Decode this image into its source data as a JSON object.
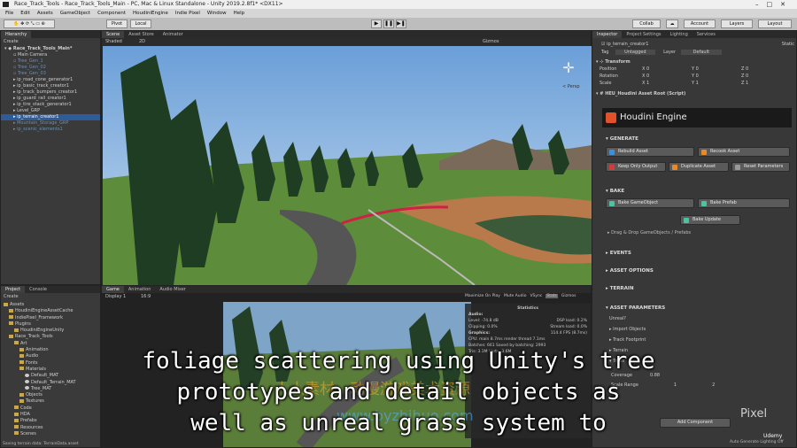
{
  "window": {
    "title": "Race_Track_Tools - Race_Track_Tools_Main - PC, Mac & Linux Standalone - Unity 2019.2.8f1* <DX11>"
  },
  "menu": [
    "File",
    "Edit",
    "Assets",
    "GameObject",
    "Component",
    "HoudiniEngine",
    "Indie Pixel",
    "Window",
    "Help"
  ],
  "toolbar": {
    "pivot": "Pivot",
    "local": "Local",
    "collab": "Collab",
    "account": "Account",
    "layers": "Layers",
    "layout": "Layout"
  },
  "hierarchy": {
    "tab": "Hierarchy",
    "create": "Create",
    "items": [
      {
        "label": "Race_Track_Tools_Main*",
        "state": "scene"
      },
      {
        "label": "Main Camera",
        "state": "normal"
      },
      {
        "label": "Tree_Gen_1",
        "state": "dim"
      },
      {
        "label": "Tree_Gen_02",
        "state": "dim"
      },
      {
        "label": "Tree_Gen_03",
        "state": "dim"
      },
      {
        "label": "ip_road_cone_generator1",
        "state": "normal"
      },
      {
        "label": "ip_basic_track_creator1",
        "state": "normal"
      },
      {
        "label": "ip_track_bumpers_creator1",
        "state": "normal"
      },
      {
        "label": "ip_guard_rail_creator1",
        "state": "normal"
      },
      {
        "label": "ip_tire_stack_generator1",
        "state": "normal"
      },
      {
        "label": "Level_GRP",
        "state": "normal"
      },
      {
        "label": "ip_terrain_creator1",
        "state": "sel"
      },
      {
        "label": "Mountain_Storage_GRP",
        "state": "dim"
      },
      {
        "label": "ip_scenic_elements1",
        "state": "dim"
      }
    ]
  },
  "scene": {
    "tabs": [
      "Scene",
      "Asset Store",
      "Animator"
    ],
    "shading": "Shaded",
    "mode": "2D",
    "gizmos": "Gizmos",
    "persp": "< Persp"
  },
  "project": {
    "tabs": [
      "Project",
      "Console"
    ],
    "create": "Create",
    "items": [
      {
        "label": "Assets",
        "depth": 0
      },
      {
        "label": "HoudiniEngineAssetCache",
        "depth": 1
      },
      {
        "label": "IndiePixel_Framework",
        "depth": 1
      },
      {
        "label": "Plugins",
        "depth": 1
      },
      {
        "label": "HoudiniEngineUnity",
        "depth": 2
      },
      {
        "label": "Race_Track_Tools",
        "depth": 1
      },
      {
        "label": "Art",
        "depth": 2
      },
      {
        "label": "Animation",
        "depth": 3
      },
      {
        "label": "Audio",
        "depth": 3
      },
      {
        "label": "Fonts",
        "depth": 3
      },
      {
        "label": "Materials",
        "depth": 3
      },
      {
        "label": "Default_MAT",
        "depth": 4
      },
      {
        "label": "Default_Terrain_MAT",
        "depth": 4
      },
      {
        "label": "Tree_MAT",
        "depth": 4
      },
      {
        "label": "Objects",
        "depth": 3
      },
      {
        "label": "Textures",
        "depth": 3
      },
      {
        "label": "Code",
        "depth": 2
      },
      {
        "label": "HDA",
        "depth": 2
      },
      {
        "label": "Prefabs",
        "depth": 2
      },
      {
        "label": "Resources",
        "depth": 2
      },
      {
        "label": "Scenes",
        "depth": 2
      }
    ],
    "status": "Saving terrain data: TerrainData.asset"
  },
  "game": {
    "tabs": [
      "Game",
      "Animation",
      "Audio Mixer"
    ],
    "display": "Display 1",
    "aspect": "16:9",
    "options": [
      "Maximize On Play",
      "Mute Audio",
      "VSync",
      "Stats",
      "Gizmos"
    ],
    "stats": {
      "title": "Statistics",
      "audio_label": "Audio:",
      "level": "Level: -74.8 dB",
      "clipping": "Clipping: 0.0%",
      "dsp": "DSP load: 0.2%",
      "stream": "Stream load: 0.0%",
      "graphics_label": "Graphics:",
      "fps": "114.4 FPS (8.7ms)",
      "cpu": "CPU: main 8.7ms  render thread 7.1ms",
      "batches": "Batches: 661  Saved by batching: 2993",
      "tris": "Tris: 3.1M  Verts: 3.6M"
    }
  },
  "inspector": {
    "tabs": [
      "Inspector",
      "Project Settings",
      "Lighting",
      "Services"
    ],
    "object": "ip_terrain_creator1",
    "static": "Static",
    "tag_label": "Tag",
    "tag": "Untagged",
    "layer_label": "Layer",
    "layer": "Default",
    "transform": {
      "title": "Transform",
      "rows": [
        {
          "label": "Position",
          "x": "0",
          "y": "0",
          "z": "0"
        },
        {
          "label": "Rotation",
          "x": "0",
          "y": "0",
          "z": "0"
        },
        {
          "label": "Scale",
          "x": "1",
          "y": "1",
          "z": "1"
        }
      ]
    },
    "script": "HEU_Houdini Asset Root (Script)",
    "houdini_title": "Houdini Engine",
    "generate": "GENERATE",
    "rebuild": "Rebuild Asset",
    "recook": "Recook Asset",
    "keep_output": "Keep Only Output",
    "duplicate": "Duplicate Asset",
    "reset_params": "Reset Parameters",
    "bake": "BAKE",
    "bake_go": "Bake GameObject",
    "bake_prefab": "Bake Prefab",
    "bake_update": "Bake Update",
    "drag_drop": "Drag & Drop GameObjects / Prefabs",
    "events": "EVENTS",
    "asset_options": "ASSET OPTIONS",
    "terrain": "TERRAIN",
    "asset_params": "ASSET PARAMETERS",
    "params": [
      "Unreal?",
      "Import Objects",
      "Track Footprint",
      "Terrain",
      "Trees"
    ],
    "coverage_label": "Coverage",
    "coverage": "0.88",
    "scale_label": "Scale Range",
    "scale_a": "1",
    "scale_b": "2",
    "add_component": "Add Component",
    "footer": "Auto Generate Lighting Off"
  },
  "subtitles": [
    "foliage scattering using Unity's tree",
    "prototypes and detail objects as",
    "well as unreal grass system to"
  ],
  "watermark": {
    "cn": "人人素材，动漫游戏美术资源",
    "url": "www.byzhihuo.com",
    "pixel": "Pixel",
    "udemy": "Udemy"
  }
}
